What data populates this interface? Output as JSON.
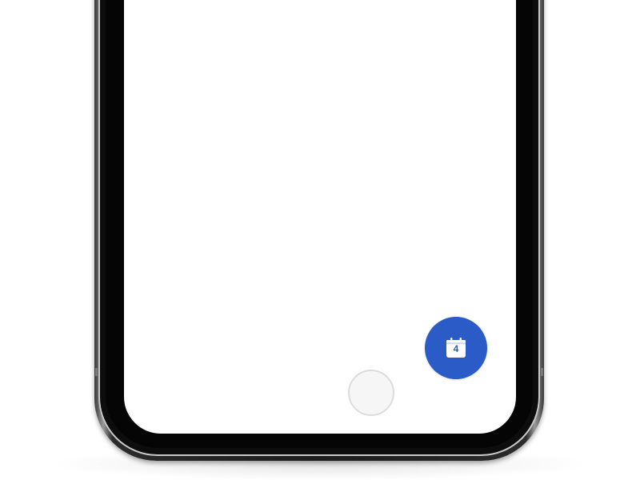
{
  "fab": {
    "icon": "calendar-icon",
    "day_number": "4",
    "color": "#2a5bc7"
  },
  "home_button": {
    "icon": "home-circle"
  },
  "device": {
    "frame_color": "#1c1c1c",
    "screen_color": "#ffffff"
  }
}
